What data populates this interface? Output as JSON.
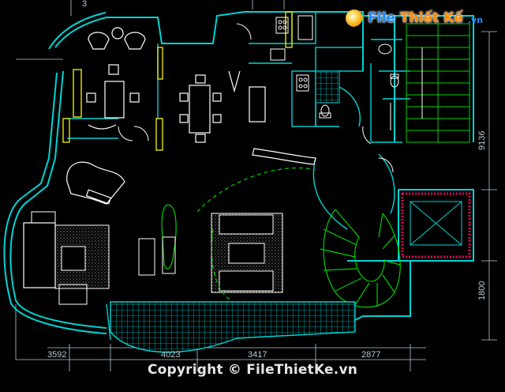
{
  "logo": {
    "word1": "File",
    "word2": "Thiết Kế",
    "suffix": ".vn"
  },
  "copyright": "Copyright © FileThietKe.vn",
  "dimensions": {
    "right_vertical": "9136",
    "right_lower": "1800",
    "bottom_left": "3592",
    "bottom_mid": "4023",
    "bottom_mid2": "3417",
    "bottom_right": "2877",
    "top_left": "3"
  },
  "colors": {
    "background": "#000000",
    "wall_cyan": "#00d4d4",
    "column_yellow": "#e6e600",
    "furniture_white": "#ffffff",
    "stair_green": "#00d000",
    "hatch_grey": "#9a9a9a",
    "elevator_red": "#e00060",
    "dimension": "#b7c9d6"
  }
}
